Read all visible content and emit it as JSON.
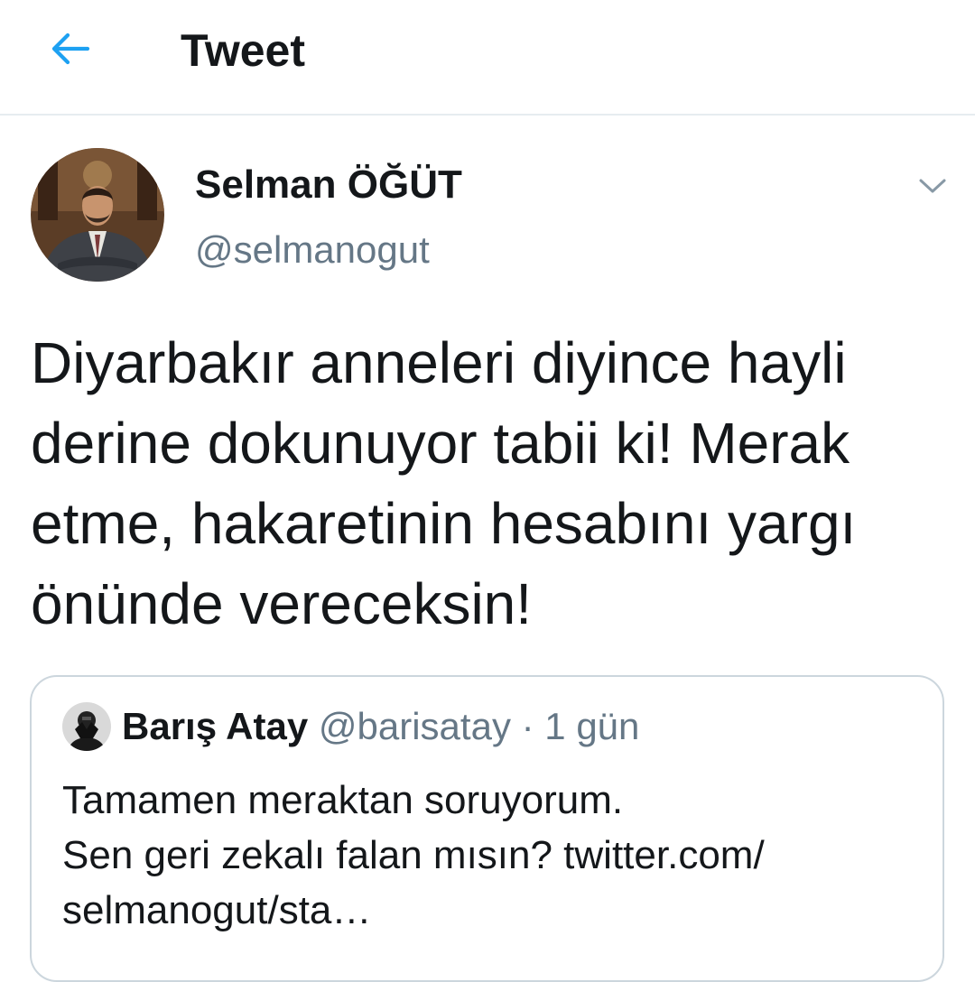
{
  "header": {
    "title": "Tweet",
    "back_icon": "arrow-left-icon",
    "accent_color": "#1da1f2"
  },
  "tweet": {
    "author": {
      "name": "Selman ÖĞÜT",
      "handle": "@selmanogut",
      "avatar": "profile-photo"
    },
    "menu_icon": "chevron-down-icon",
    "text": "Diyarbakır anneleri diyince hayli derine dokunuyor tabii ki! Merak etme, hakaretinin hesabını yargı önünde vereceksin!",
    "quoted": {
      "author_name": "Barış Atay",
      "author_handle": "@barisatay",
      "separator": "·",
      "time": "1 gün",
      "lines": [
        "Tamamen meraktan soruyorum.",
        "Sen geri zekalı falan mısın? twitter.com/",
        "selmanogut/sta…"
      ]
    }
  },
  "colors": {
    "text_primary": "#14171a",
    "text_secondary": "#657786",
    "border": "#ccd6dd",
    "divider": "#e6ecf0"
  }
}
